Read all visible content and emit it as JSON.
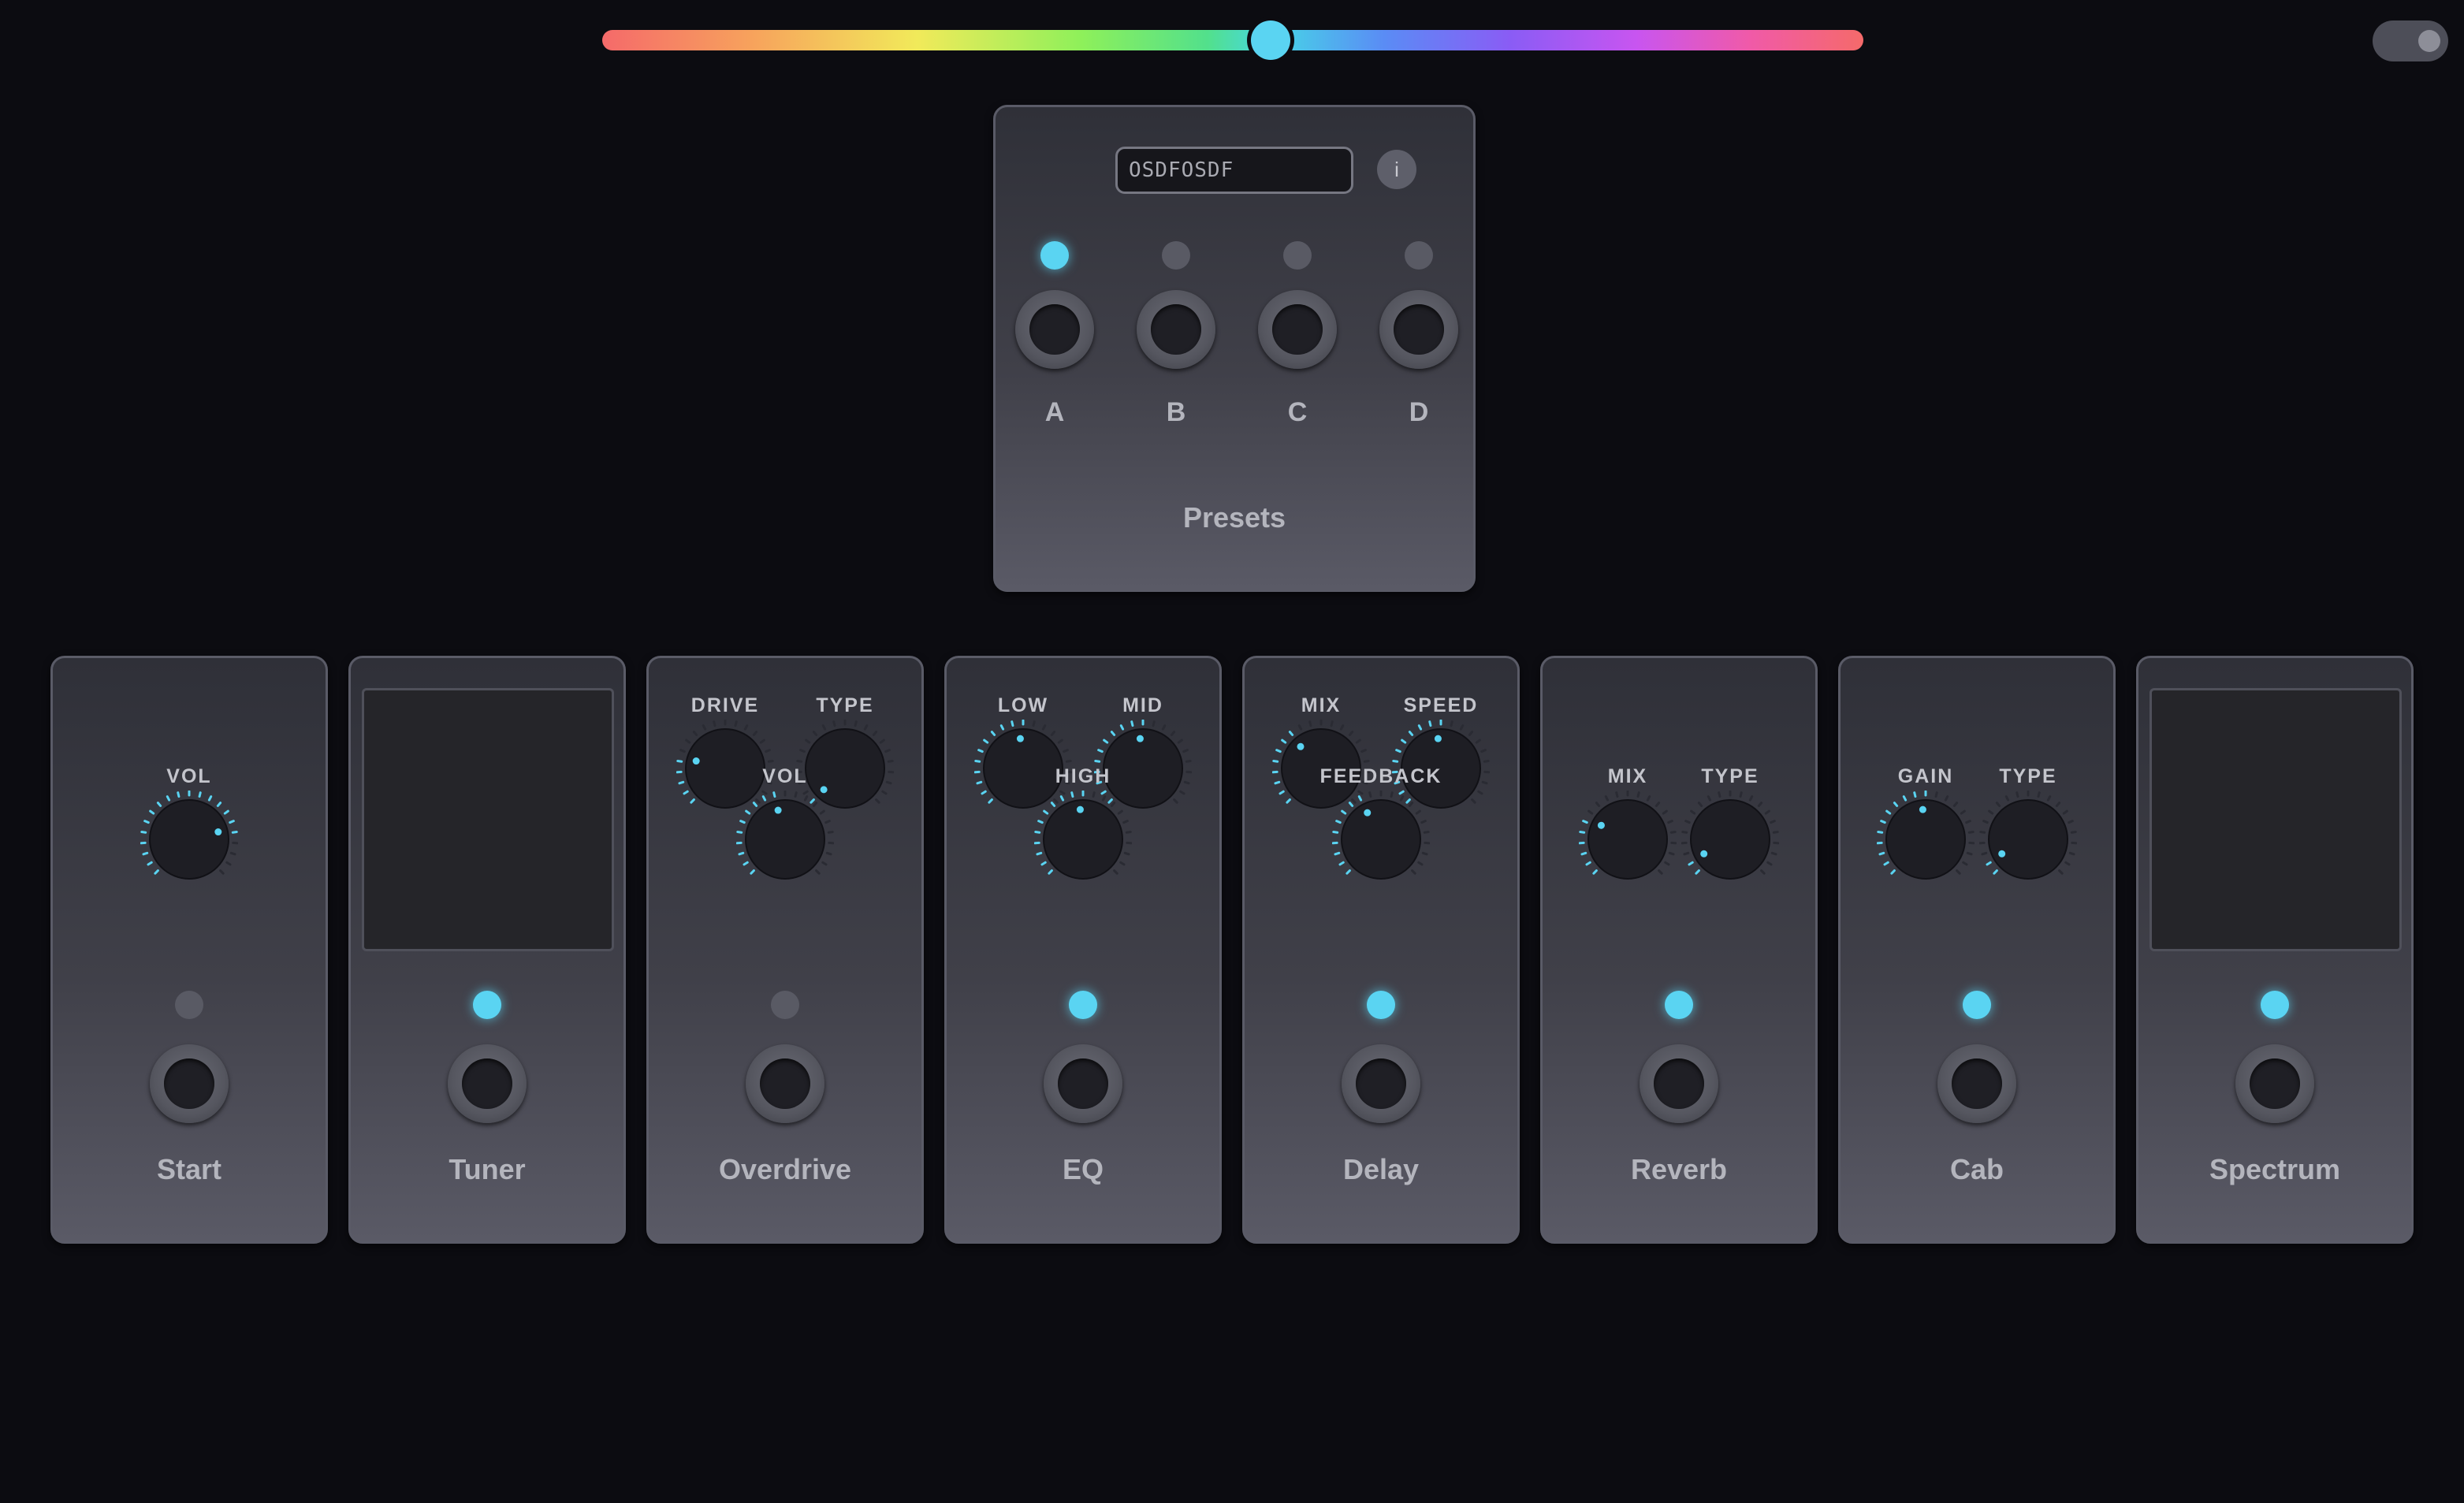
{
  "colors": {
    "accent": "#5ad4f2",
    "led_off": "#595a64",
    "background": "#0c0c11",
    "panel": "#404049"
  },
  "hue_slider": {
    "value": 0.53
  },
  "theme_toggle": {
    "state": "on"
  },
  "presets": {
    "name": "Presets",
    "display_text": "OSDFOSDF",
    "info_icon": "info-icon",
    "info_label": "i",
    "slots": [
      {
        "letter": "A",
        "active": true
      },
      {
        "letter": "B",
        "active": false
      },
      {
        "letter": "C",
        "active": false
      },
      {
        "letter": "D",
        "active": false
      }
    ]
  },
  "pedals": [
    {
      "name": "Start",
      "led_on": false,
      "knobs": [
        {
          "label": "VOL",
          "value": 0.78
        }
      ]
    },
    {
      "name": "Tuner",
      "led_on": true,
      "screen": true
    },
    {
      "name": "Overdrive",
      "led_on": false,
      "knobs": [
        {
          "label": "DRIVE",
          "value": 0.22
        },
        {
          "label": "TYPE",
          "value": 0.0
        },
        {
          "label": "VOL",
          "value": 0.45
        }
      ]
    },
    {
      "name": "EQ",
      "led_on": true,
      "knobs": [
        {
          "label": "LOW",
          "value": 0.48
        },
        {
          "label": "MID",
          "value": 0.48
        },
        {
          "label": "HIGH",
          "value": 0.48
        }
      ]
    },
    {
      "name": "Delay",
      "led_on": true,
      "knobs": [
        {
          "label": "MIX",
          "value": 0.34
        },
        {
          "label": "SPEED",
          "value": 0.48
        },
        {
          "label": "FEEDBACK",
          "value": 0.4
        }
      ]
    },
    {
      "name": "Reverb",
      "led_on": true,
      "knobs": [
        {
          "label": "MIX",
          "value": 0.27
        },
        {
          "label": "TYPE",
          "value": 0.06
        }
      ]
    },
    {
      "name": "Cab",
      "led_on": true,
      "knobs": [
        {
          "label": "GAIN",
          "value": 0.48
        },
        {
          "label": "TYPE",
          "value": 0.06
        }
      ]
    },
    {
      "name": "Spectrum",
      "led_on": true,
      "screen": true
    }
  ]
}
